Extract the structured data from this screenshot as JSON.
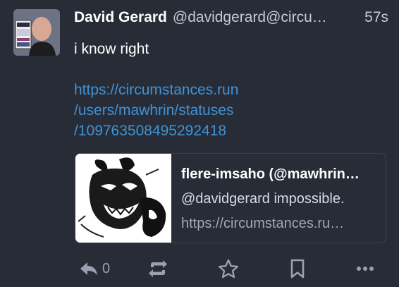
{
  "post": {
    "author": {
      "display_name": "David Gerard",
      "handle": "@davidgerard@circu…",
      "avatar_icon": "avatar-photo"
    },
    "timestamp": "57s",
    "text": "i know right",
    "link_lines": [
      "https://circumstances.run",
      "/users/mawhrin/statuses",
      "/109763508495292418"
    ],
    "card": {
      "title": "flere-imsaho (@mawhrin…",
      "description": "@davidgerard impossible.",
      "url": "https://circumstances.ru…",
      "thumbnail_icon": "demon-sketch-thumbnail"
    },
    "actions": {
      "reply_icon": "reply-icon",
      "reply_count": "0",
      "boost_icon": "boost-icon",
      "favourite_icon": "star-icon",
      "bookmark_icon": "bookmark-icon",
      "more_icon": "more-icon"
    }
  },
  "colors": {
    "background": "#282c37",
    "link": "#3f93d6",
    "muted": "#9aa0b0",
    "card_border": "#3d4252"
  }
}
